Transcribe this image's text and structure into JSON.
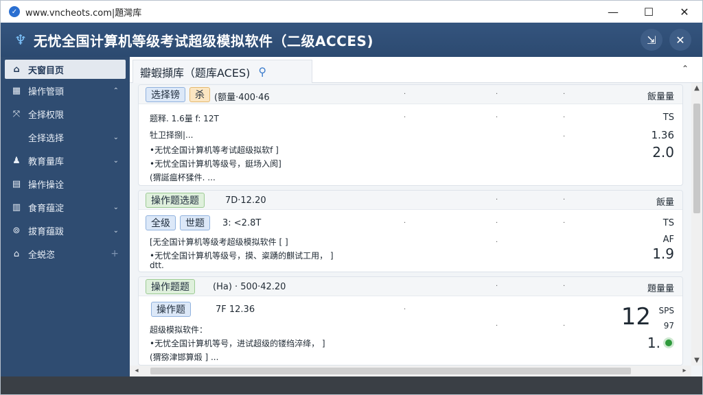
{
  "titlebar": {
    "url": "www.vncheots.com|題灣库",
    "icon": "check-shield-icon",
    "minimize": "—",
    "maximize": "☐",
    "close": "✕"
  },
  "app": {
    "title": "无忧全国计算机等级考试超级模拟软件（二级ACCES)",
    "logo_icon": "app-logo-icon",
    "header_btn1": "export-icon",
    "header_btn2": "shuffle-icon"
  },
  "sidebar": {
    "items": [
      {
        "label": "天窗目页",
        "icon": "home-icon"
      },
      {
        "label": "操作管頭",
        "icon": "grid-icon",
        "chevron": "⌃"
      },
      {
        "label": "全择权限",
        "icon": "share-icon"
      },
      {
        "label": "全择选择",
        "chevron": "⌄"
      },
      {
        "label": "教育量库",
        "icon": "user-icon",
        "chevron": "⌄"
      },
      {
        "label": "操作操诠",
        "icon": "document-icon"
      },
      {
        "label": "食育蕴淀",
        "icon": "list-icon",
        "chevron": "⌄"
      },
      {
        "label": "拔育蕴跋",
        "icon": "location-icon",
        "chevron": "⌄"
      },
      {
        "label": "全蜕恣",
        "icon": "home-outline-icon",
        "plus": "+"
      }
    ]
  },
  "tab": {
    "label": "瓣蝦擷库（题库ACES)",
    "pin": "⚲"
  },
  "cards": [
    {
      "tags": [
        {
          "text": "选择镑",
          "color": "blue"
        },
        {
          "text": "杀",
          "color": "orange"
        }
      ],
      "head_text": "(额量·400·46",
      "head_right": "飯量量",
      "lines": [
        "题释.  1.6量 f: 12T",
        "牡卫择捌|...",
        "•无忧全国计算机等考试超级拟软f  ]",
        "•无忧全国计算机等级号，鋌场入阂]",
        "(猬誕瘟杯猱件.  ..."
      ],
      "right_values": [
        "TS",
        "1.36",
        "2.0"
      ]
    },
    {
      "tags": [
        {
          "text": "操作题选题",
          "color": "green"
        }
      ],
      "head_text": "7D·12.20",
      "head_right": "飯量",
      "tags2": [
        {
          "text": "全级",
          "color": "blue"
        },
        {
          "text": "世题",
          "color": "blue"
        }
      ],
      "head2_text": "3: <2.8T",
      "lines": [
        "[无全国计算机等级考超级模拟软件 [  ]",
        "•无忧全国计算机等级号，摸、粢踴的麒试工用，  ]",
        "dtt."
      ],
      "right_values": [
        "TS",
        "AF",
        "1.9"
      ]
    },
    {
      "tags": [
        {
          "text": "操作题题",
          "color": "green"
        }
      ],
      "head_text": "(Ha) · 500·42.20",
      "head_right": "題量量",
      "tags2": [
        {
          "text": "操作题",
          "color": "blue"
        }
      ],
      "head2_text": "7F 12.36",
      "lines": [
        "超级模拟软件：",
        "•无忧全国计算机等号，进试超级的镂绉淬绛，  ]",
        "(猬猕津邯算煅 ]  ..."
      ],
      "right_values": [
        "12",
        "SPS",
        "97",
        "1."
      ]
    }
  ]
}
